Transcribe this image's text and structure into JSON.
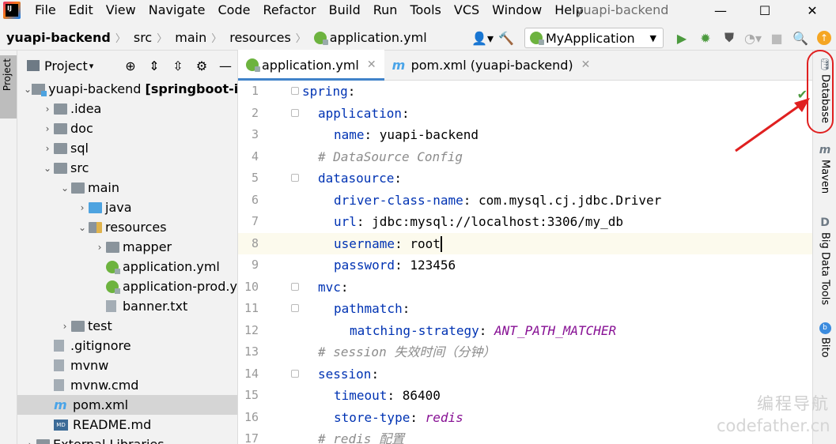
{
  "menu": {
    "items": [
      "File",
      "Edit",
      "View",
      "Navigate",
      "Code",
      "Refactor",
      "Build",
      "Run",
      "Tools",
      "VCS",
      "Window",
      "Help"
    ],
    "window_title": "yuapi-backend"
  },
  "breadcrumb": {
    "items": [
      "yuapi-backend",
      "src",
      "main",
      "resources",
      "application.yml"
    ]
  },
  "run_config": {
    "label": "MyApplication"
  },
  "project_panel": {
    "title": "Project",
    "tree": [
      {
        "label": "yuapi-backend [springboot-ini",
        "depth": 0,
        "type": "module",
        "expanded": true
      },
      {
        "label": ".idea",
        "depth": 1,
        "type": "folder",
        "expanded": false
      },
      {
        "label": "doc",
        "depth": 1,
        "type": "folder",
        "expanded": false
      },
      {
        "label": "sql",
        "depth": 1,
        "type": "folder",
        "expanded": false
      },
      {
        "label": "src",
        "depth": 1,
        "type": "folder",
        "expanded": true
      },
      {
        "label": "main",
        "depth": 2,
        "type": "folder",
        "expanded": true
      },
      {
        "label": "java",
        "depth": 3,
        "type": "folder-blue",
        "expanded": false
      },
      {
        "label": "resources",
        "depth": 3,
        "type": "folder-res",
        "expanded": true
      },
      {
        "label": "mapper",
        "depth": 4,
        "type": "folder",
        "expanded": false
      },
      {
        "label": "application.yml",
        "depth": 4,
        "type": "yml"
      },
      {
        "label": "application-prod.y",
        "depth": 4,
        "type": "yml"
      },
      {
        "label": "banner.txt",
        "depth": 4,
        "type": "file"
      },
      {
        "label": "test",
        "depth": 2,
        "type": "folder",
        "expanded": false
      },
      {
        "label": ".gitignore",
        "depth": 1,
        "type": "file"
      },
      {
        "label": "mvnw",
        "depth": 1,
        "type": "file"
      },
      {
        "label": "mvnw.cmd",
        "depth": 1,
        "type": "file"
      },
      {
        "label": "pom.xml",
        "depth": 1,
        "type": "maven",
        "selected": true
      },
      {
        "label": "README.md",
        "depth": 1,
        "type": "md"
      },
      {
        "label": "External Libraries",
        "depth": 0,
        "type": "folder",
        "expanded": false
      }
    ]
  },
  "editor": {
    "tabs": [
      {
        "label": "application.yml",
        "active": true
      },
      {
        "label": "pom.xml (yuapi-backend)",
        "active": false
      }
    ],
    "current_line": 8,
    "lines": [
      {
        "n": "1",
        "indent": 0,
        "kind": "key",
        "key": "spring",
        "sep": ":",
        "value": ""
      },
      {
        "n": "2",
        "indent": 1,
        "kind": "key",
        "key": "application",
        "sep": ":",
        "value": ""
      },
      {
        "n": "3",
        "indent": 2,
        "kind": "key",
        "key": "name",
        "sep": ": ",
        "value": "yuapi-backend"
      },
      {
        "n": "4",
        "indent": 1,
        "kind": "comment",
        "text": "# DataSource Config"
      },
      {
        "n": "5",
        "indent": 1,
        "kind": "key",
        "key": "datasource",
        "sep": ":",
        "value": ""
      },
      {
        "n": "6",
        "indent": 2,
        "kind": "key",
        "key": "driver-class-name",
        "sep": ": ",
        "value": "com.mysql.cj.jdbc.Driver"
      },
      {
        "n": "7",
        "indent": 2,
        "kind": "key",
        "key": "url",
        "sep": ": ",
        "value": "jdbc:mysql://localhost:3306/my_db"
      },
      {
        "n": "8",
        "indent": 2,
        "kind": "key",
        "key": "username",
        "sep": ": ",
        "value": "root"
      },
      {
        "n": "9",
        "indent": 2,
        "kind": "key",
        "key": "password",
        "sep": ": ",
        "value": "123456"
      },
      {
        "n": "10",
        "indent": 1,
        "kind": "key",
        "key": "mvc",
        "sep": ":",
        "value": ""
      },
      {
        "n": "11",
        "indent": 2,
        "kind": "key",
        "key": "pathmatch",
        "sep": ":",
        "value": ""
      },
      {
        "n": "12",
        "indent": 3,
        "kind": "key",
        "key": "matching-strategy",
        "sep": ": ",
        "value": "ANT_PATH_MATCHER",
        "enum": true
      },
      {
        "n": "13",
        "indent": 1,
        "kind": "comment",
        "text": "# session 失效时间（分钟）"
      },
      {
        "n": "14",
        "indent": 1,
        "kind": "key",
        "key": "session",
        "sep": ":",
        "value": ""
      },
      {
        "n": "15",
        "indent": 2,
        "kind": "key",
        "key": "timeout",
        "sep": ": ",
        "value": "86400"
      },
      {
        "n": "16",
        "indent": 2,
        "kind": "key",
        "key": "store-type",
        "sep": ": ",
        "value": "redis",
        "enum": true
      },
      {
        "n": "17",
        "indent": 1,
        "kind": "comment",
        "text": "# redis 配置"
      }
    ]
  },
  "left_strip": {
    "label": "Project"
  },
  "right_strip": {
    "items": [
      "Database",
      "Maven",
      "Big Data Tools",
      "Bito"
    ]
  },
  "watermark": {
    "line1": "编程导航",
    "line2": "codefather.cn"
  },
  "colors": {
    "keyword": "#0033b3",
    "comment": "#8c8c8c",
    "enum": "#871094",
    "highlight": "#e02020",
    "run_green": "#4c9a3e"
  }
}
